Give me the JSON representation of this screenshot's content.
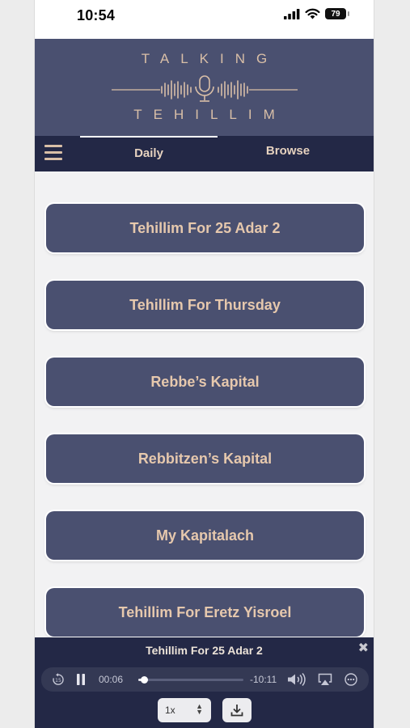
{
  "status": {
    "time": "10:54",
    "battery": "79"
  },
  "header": {
    "logo_top": "TALKING",
    "logo_bottom": "TEHILLIM"
  },
  "nav": {
    "tabs": [
      {
        "label": "Daily",
        "selected": true
      },
      {
        "label": "Browse",
        "selected": false
      }
    ]
  },
  "list": {
    "items": [
      {
        "label": "Tehillim For 25 Adar 2"
      },
      {
        "label": "Tehillim For Thursday"
      },
      {
        "label": "Rebbe’s Kapital"
      },
      {
        "label": "Rebbitzen’s Kapital"
      },
      {
        "label": "My Kapitalach"
      },
      {
        "label": "Tehillim For Eretz Yisroel"
      }
    ]
  },
  "player": {
    "title": "Tehillim For 25 Adar 2",
    "elapsed": "00:06",
    "remaining": "-10:11",
    "progress_fraction": 0.05,
    "speed": "1x",
    "state": "playing"
  },
  "icons": [
    "menu-icon",
    "replay-icon",
    "pause-icon",
    "volume-icon",
    "airplay-icon",
    "more-icon",
    "download-icon",
    "close-icon",
    "microphone-icon",
    "signal-icon",
    "wifi-icon",
    "battery-icon"
  ],
  "colors": {
    "header_bg": "#4a5070",
    "nav_bg": "#232846",
    "accent_text": "#d9bfa7",
    "button_bg": "#4a5070"
  }
}
